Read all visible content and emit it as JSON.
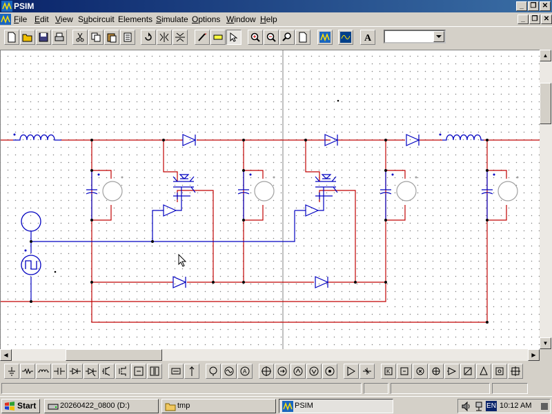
{
  "window": {
    "title": "PSIM",
    "caption_buttons": [
      "_",
      "❐",
      "✕"
    ]
  },
  "menubar": {
    "items": [
      {
        "label": "File",
        "accel": "F"
      },
      {
        "label": "Edit",
        "accel": "E"
      },
      {
        "label": "View",
        "accel": "V"
      },
      {
        "label": "Subcircuit",
        "accel": "u"
      },
      {
        "label": "Elements",
        "accel": ""
      },
      {
        "label": "Simulate",
        "accel": "S"
      },
      {
        "label": "Options",
        "accel": "O"
      },
      {
        "label": "Window",
        "accel": "W"
      },
      {
        "label": "Help",
        "accel": "H"
      }
    ],
    "mdi_buttons": [
      "_",
      "❐",
      "✕"
    ]
  },
  "toolbar": {
    "buttons": [
      "new",
      "open",
      "save",
      "print",
      "cut",
      "copy",
      "paste",
      "paste-special",
      "rotate",
      "flip-horizontal",
      "flip-vertical",
      "wire",
      "label",
      "select",
      "zoom-in",
      "zoom-out",
      "zoom-fit",
      "page",
      "simulate",
      "simview",
      "text"
    ],
    "text_tool_glyph": "A",
    "combo_value": ""
  },
  "element_bar": {
    "buttons": [
      "ground",
      "resistor",
      "inductor",
      "capacitor",
      "diode",
      "diode-bidirectional",
      "thyristor",
      "igbt",
      "mosfet",
      "switch-module",
      "transformer",
      "dc-source",
      "ac-source",
      "sine-source",
      "ammeter",
      "voltmeter",
      "voltage-probe",
      "current-probe",
      "wattmeter",
      "varmeter",
      "probe",
      "comparator",
      "limiter",
      "gain",
      "integrator",
      "summer",
      "sampler",
      "multiplier",
      "triangle-source",
      "step",
      "const"
    ]
  },
  "taskbar": {
    "start_label": "Start",
    "tasks": [
      {
        "label": "20260422_0800 (D:)",
        "icon": "drive-icon"
      },
      {
        "label": "tmp",
        "icon": "folder-icon"
      },
      {
        "label": "PSIM",
        "icon": "psim-icon",
        "active": true
      }
    ],
    "tray": {
      "lang": "EN",
      "clock": "10:12 AM"
    }
  },
  "colors": {
    "wire_power": "#c00000",
    "wire_control": "#0000c0",
    "title_bar": "#0a246a",
    "device_outline": "#000000"
  }
}
